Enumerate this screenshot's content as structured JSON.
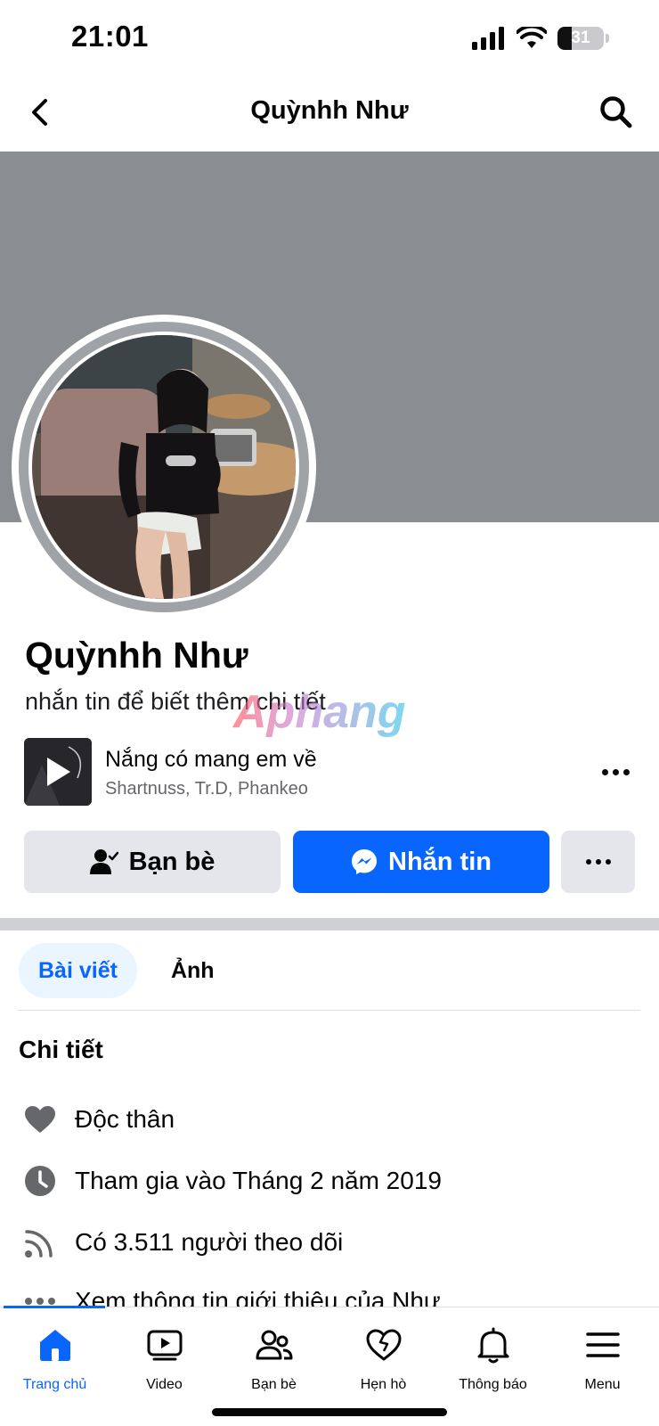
{
  "status_bar": {
    "time": "21:01",
    "battery": "31"
  },
  "header": {
    "title": "Quỳnhh Như"
  },
  "profile": {
    "name": "Quỳnhh Như",
    "bio": "nhắn tin để biết thêm chi tiết",
    "watermark": "Aphang"
  },
  "music": {
    "title": "Nắng có mang em về",
    "artists": "Shartnuss, Tr.D, Phankeo"
  },
  "actions": {
    "friends_label": "Bạn bè",
    "message_label": "Nhắn tin"
  },
  "tabs": [
    {
      "label": "Bài viết",
      "active": true
    },
    {
      "label": "Ảnh",
      "active": false
    }
  ],
  "details": {
    "title": "Chi tiết",
    "items": [
      {
        "icon": "heart-icon",
        "text": "Độc thân"
      },
      {
        "icon": "clock-icon",
        "text": "Tham gia vào Tháng 2 năm 2019"
      },
      {
        "icon": "rss-icon",
        "text": "Có 3.511 người theo dõi"
      },
      {
        "icon": "more-icon",
        "text": "Xem thông tin giới thiệu của Như"
      }
    ]
  },
  "bottom_nav": [
    {
      "label": "Trang chủ",
      "icon": "home-icon",
      "active": true
    },
    {
      "label": "Video",
      "icon": "video-icon",
      "active": false
    },
    {
      "label": "Bạn bè",
      "icon": "friends-icon",
      "active": false
    },
    {
      "label": "Hẹn hò",
      "icon": "dating-icon",
      "active": false
    },
    {
      "label": "Thông báo",
      "icon": "bell-icon",
      "active": false
    },
    {
      "label": "Menu",
      "icon": "menu-icon",
      "active": false
    }
  ],
  "colors": {
    "accent": "#0866ff",
    "cover": "#8a8d91",
    "button_gray": "#e4e6eb"
  }
}
